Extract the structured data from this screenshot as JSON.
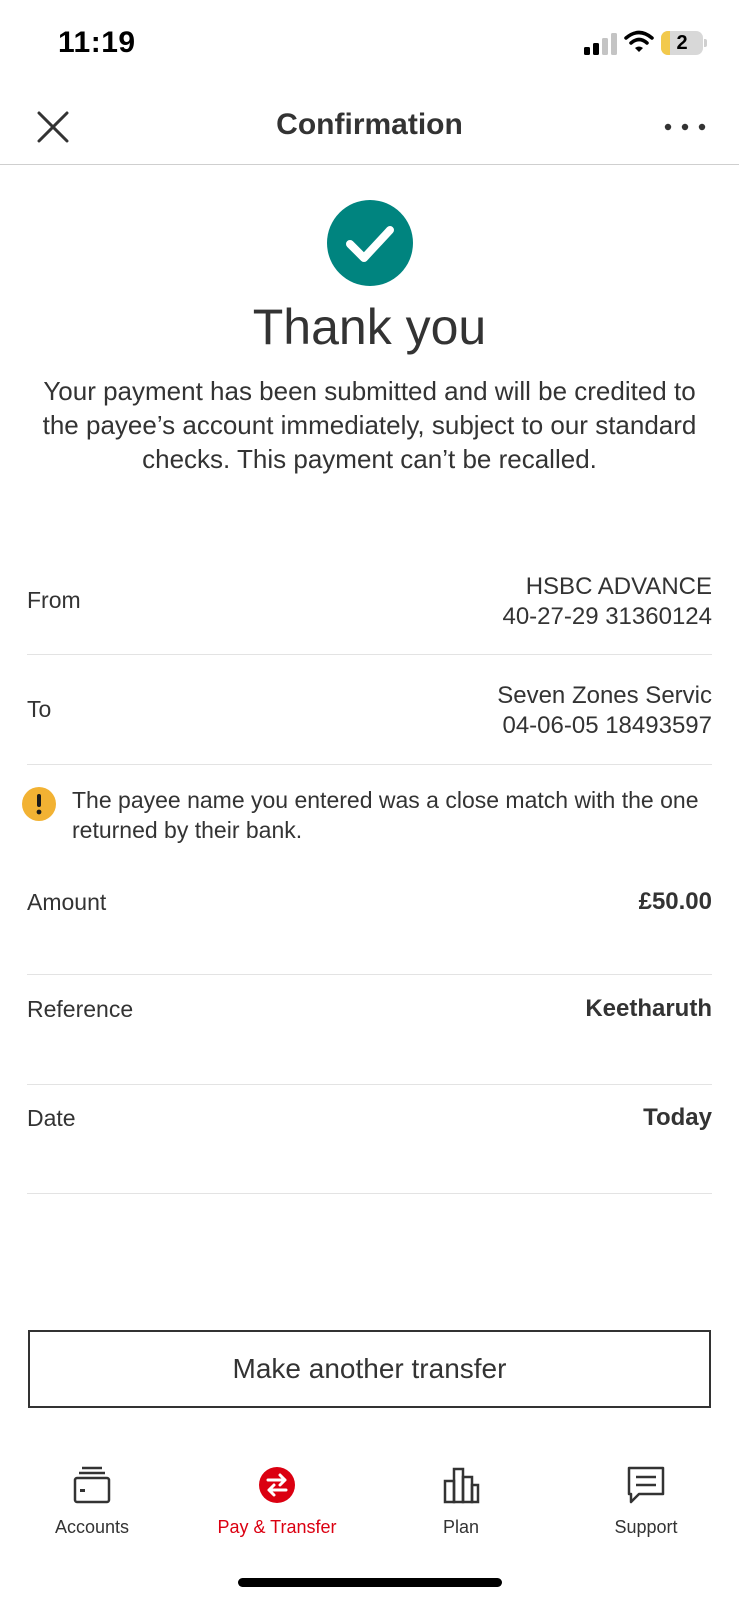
{
  "status_bar": {
    "time": "11:19",
    "battery_level": "2"
  },
  "header": {
    "title": "Confirmation",
    "close_icon": "close-icon",
    "more_icon": "more-dots-icon"
  },
  "success": {
    "icon": "check-circle-icon",
    "title": "Thank you",
    "message": "Your payment has been submitted and will be credited to the payee’s account immediately, subject to our standard checks. This payment can’t be recalled."
  },
  "details": {
    "from": {
      "label": "From",
      "line1": "HSBC ADVANCE",
      "line2": "40-27-29 31360124"
    },
    "to": {
      "label": "To",
      "line1": "Seven Zones Servic",
      "line2": "04-06-05 18493597"
    },
    "warning": {
      "icon": "warning-icon",
      "text": "The payee name you entered was a close match with the one returned by their bank."
    },
    "amount": {
      "label": "Amount",
      "value": "£50.00"
    },
    "reference": {
      "label": "Reference",
      "value": "Keetharuth"
    },
    "date": {
      "label": "Date",
      "value": "Today"
    }
  },
  "actions": {
    "make_another_transfer": "Make another transfer"
  },
  "bottom_nav": {
    "items": [
      {
        "label": "Accounts",
        "icon": "wallet-icon"
      },
      {
        "label": "Pay & Transfer",
        "icon": "transfer-arrows-icon",
        "active": true
      },
      {
        "label": "Plan",
        "icon": "bar-chart-icon"
      },
      {
        "label": "Support",
        "icon": "chat-icon"
      }
    ]
  },
  "colors": {
    "success": "#00847f",
    "accent": "#db0011",
    "warning": "#f2b233",
    "text": "#333333"
  }
}
